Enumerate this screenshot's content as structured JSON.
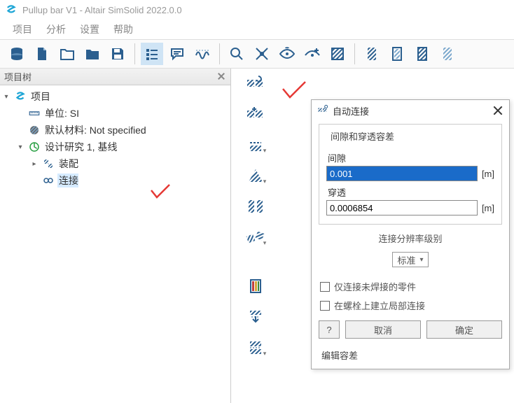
{
  "app": {
    "title": "Pullup bar V1 - Altair SimSolid 2022.0.0"
  },
  "menu": {
    "items": [
      "项目",
      "分析",
      "设置",
      "帮助"
    ]
  },
  "toolbar_top": {
    "items": [
      "db",
      "new",
      "open",
      "folder",
      "save",
      "sep",
      "list",
      "comment",
      "wave",
      "sep",
      "zoom",
      "isolate",
      "show",
      "showadd",
      "hatchbox",
      "sep",
      "bigstripe1",
      "bigstripe2",
      "bigstripe3",
      "bigstripe4"
    ]
  },
  "project_tree": {
    "title": "项目树",
    "root": "项目",
    "units_label": "单位: SI",
    "material_label": "默认材料: Not specified",
    "study_label": "设计研究 1, 基线",
    "assembly_label": "装配",
    "connection_label": "连接"
  },
  "dialog": {
    "title": "自动连接",
    "group_title": "间隙和穿透容差",
    "gap_label": "间隙",
    "gap_value": "0.001",
    "pen_label": "穿透",
    "pen_value": "0.0006854",
    "unit": "[m]",
    "res_title": "连接分辨率级别",
    "res_value": "标准",
    "cb1": "仅连接未焊接的零件",
    "cb2": "在螺栓上建立局部连接",
    "help": "?",
    "cancel": "取消",
    "ok": "确定",
    "edit_tol": "编辑容差"
  }
}
